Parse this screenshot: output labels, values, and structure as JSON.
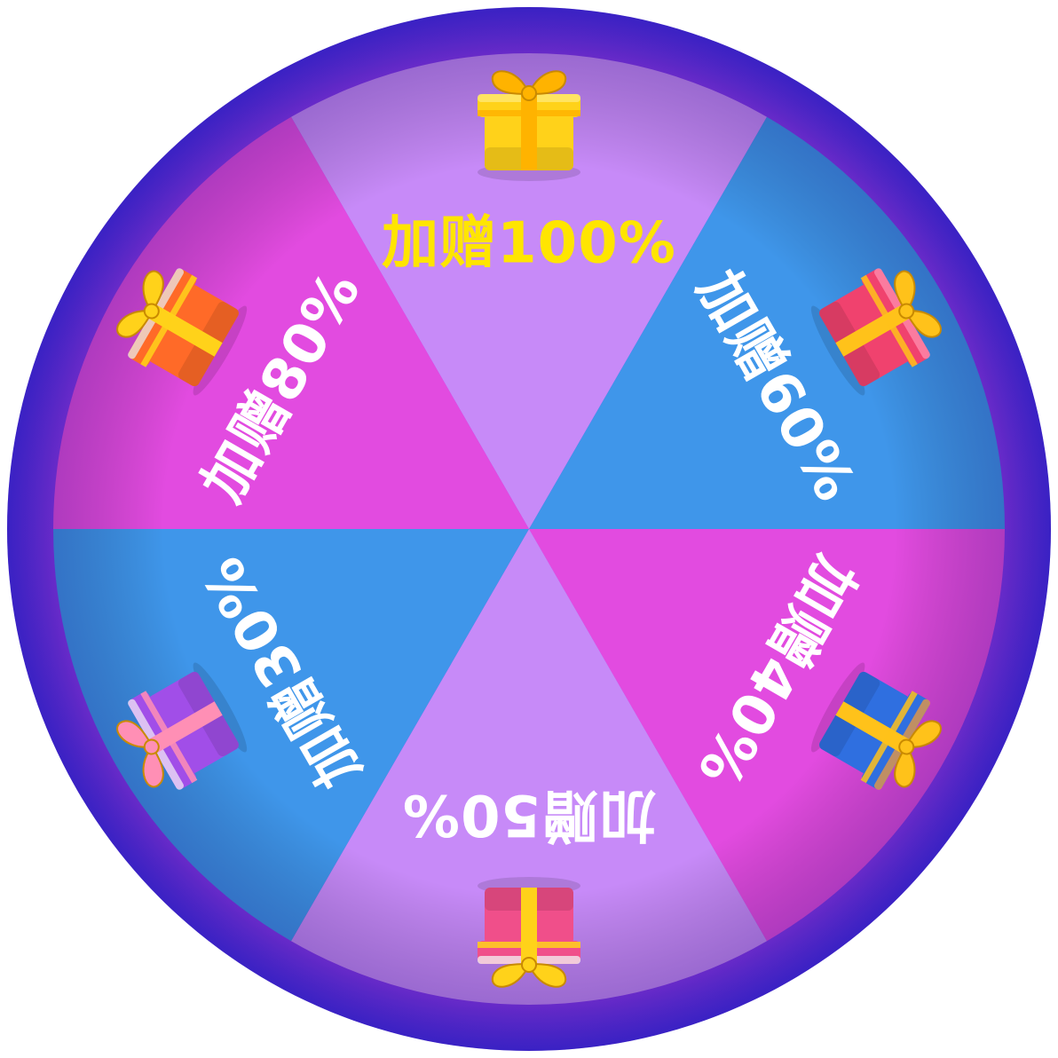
{
  "wheel": {
    "rim_color": "#4b2ee8",
    "rim_glow_color": "#b23cf0",
    "segments": [
      {
        "label": "加赠100%",
        "fill": "#c78af8",
        "text_color": "#ffe500",
        "gift": "gold-gift-box-icon",
        "gift_colors": [
          "#ffd21a",
          "#ffb300",
          "#ffe97a"
        ]
      },
      {
        "label": "加赠60%",
        "fill": "#3f96ea",
        "text_color": "#ffffff",
        "gift": "red-gift-box-icon",
        "gift_colors": [
          "#f0426e",
          "#ffc21a",
          "#ff8fb0"
        ]
      },
      {
        "label": "加赠40%",
        "fill": "#e24be0",
        "text_color": "#ffffff",
        "gift": "blue-gift-box-icon",
        "gift_colors": [
          "#2f6fe0",
          "#ffc21a",
          "#f29a3a"
        ]
      },
      {
        "label": "加赠50%",
        "fill": "#c78af8",
        "text_color": "#ffffff",
        "gift": "pink-gift-box-icon",
        "gift_colors": [
          "#f04f8a",
          "#ffd21a",
          "#f3f3f3"
        ]
      },
      {
        "label": "加赠30%",
        "fill": "#3f96ea",
        "text_color": "#ffffff",
        "gift": "purple-gift-box-icon",
        "gift_colors": [
          "#a14ee8",
          "#ff8fb5",
          "#f0e8f5"
        ]
      },
      {
        "label": "加赠80%",
        "fill": "#e24be0",
        "text_color": "#ffffff",
        "gift": "orange-gift-box-icon",
        "gift_colors": [
          "#ff6a28",
          "#ffd21a",
          "#e8e8e8"
        ]
      }
    ]
  }
}
